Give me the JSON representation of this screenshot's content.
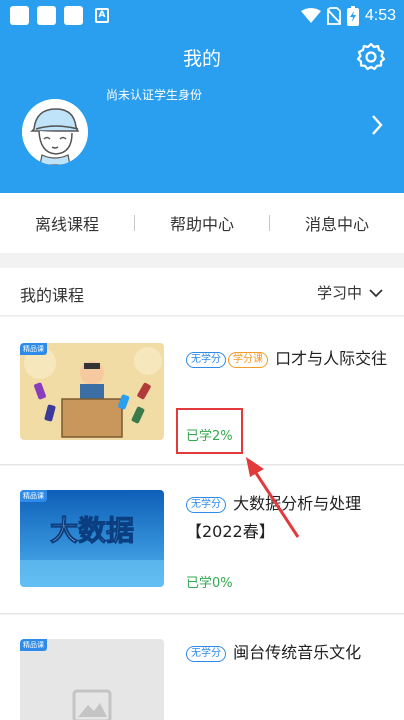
{
  "status_bar": {
    "time": "4:53",
    "icons": [
      "notification-square-1",
      "notification-square-2",
      "notification-square-3",
      "a-icon",
      "wifi-icon",
      "no-sim-icon",
      "battery-icon"
    ]
  },
  "header": {
    "title": "我的",
    "auth_status": "尚未认证学生身份",
    "icons": [
      "settings-gear-icon",
      "chevron-right-icon"
    ]
  },
  "quick_links": [
    {
      "label": "离线课程"
    },
    {
      "label": "帮助中心"
    },
    {
      "label": "消息中心"
    }
  ],
  "my_courses": {
    "title": "我的课程",
    "filter_label": "学习中",
    "items": [
      {
        "tag": "精品课",
        "badges": [
          "无学分",
          "学分课"
        ],
        "title": "口才与人际交往",
        "progress_label": "已学2%",
        "progress_value": 2
      },
      {
        "tag": "精品课",
        "badges": [
          "无学分"
        ],
        "title": "大数据分析与处理【2022春】",
        "progress_label": "已学0%",
        "progress_value": 0,
        "thumb_text": "大数据"
      },
      {
        "tag": "精品课",
        "badges": [
          "无学分"
        ],
        "title": "闽台传统音乐文化",
        "progress_label": "",
        "progress_value": null
      }
    ]
  },
  "colors": {
    "header_bg": "#2a9ff0",
    "progress_green": "#33a84e",
    "annotation_red": "#e23a3a",
    "badge_blue": "#2f8be9",
    "badge_orange": "#f39a27"
  }
}
